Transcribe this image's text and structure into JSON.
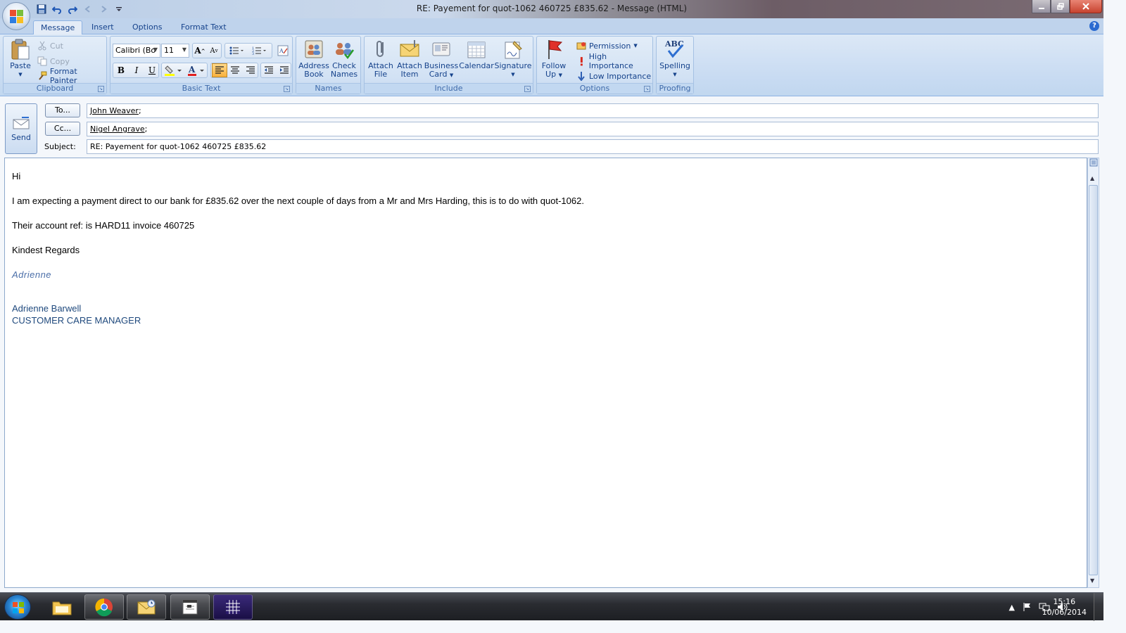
{
  "window": {
    "title": "RE: Payement for quot-1062 460725 £835.62  -  Message (HTML)"
  },
  "tabs": [
    {
      "label": "Message"
    },
    {
      "label": "Insert"
    },
    {
      "label": "Options"
    },
    {
      "label": "Format Text"
    }
  ],
  "ribbon": {
    "clipboard": {
      "paste": "Paste",
      "cut": "Cut",
      "copy": "Copy",
      "format_painter": "Format Painter",
      "label": "Clipboard"
    },
    "basic_text": {
      "font": "Calibri (Bo",
      "size": "11",
      "bold": "B",
      "italic": "I",
      "underline": "U",
      "label": "Basic Text"
    },
    "names": {
      "address_book_1": "Address",
      "address_book_2": "Book",
      "check_names_1": "Check",
      "check_names_2": "Names",
      "label": "Names"
    },
    "include": {
      "attach_file_1": "Attach",
      "attach_file_2": "File",
      "attach_item_1": "Attach",
      "attach_item_2": "Item",
      "business_card_1": "Business",
      "business_card_2": "Card",
      "calendar": "Calendar",
      "signature": "Signature",
      "label": "Include"
    },
    "options": {
      "follow_up_1": "Follow",
      "follow_up_2": "Up",
      "permission": "Permission",
      "high_importance": "High Importance",
      "low_importance": "Low Importance",
      "label": "Options"
    },
    "proofing": {
      "spelling": "Spelling",
      "spelling_icon_text": "ABC",
      "label": "Proofing"
    }
  },
  "header": {
    "send": "Send",
    "to_button": "To...",
    "to_value": "John Weaver",
    "to_sep": ";",
    "cc_button": "Cc...",
    "cc_value": "Nigel Angrave",
    "cc_sep": ";",
    "subject_label": "Subject:",
    "subject_value": "RE: Payement for quot-1062 460725 £835.62"
  },
  "body": {
    "greeting": "Hi",
    "line1": "I am expecting a payment direct to our bank for £835.62 over the next couple of days from a Mr and Mrs Harding, this is to do with quot-1062.",
    "line2": "Their account ref: is HARD11 invoice 460725",
    "closing": "Kindest Regards",
    "signature_script": "Adrienne",
    "signature_name": "Adrienne Barwell",
    "signature_role": "CUSTOMER CARE MANAGER"
  },
  "taskbar": {
    "time": "15:16",
    "date": "10/06/2014"
  },
  "colors": {
    "ribbon_blue": "#c8dbf2",
    "tab_text": "#15428b",
    "signature_blue": "#1f497d"
  }
}
